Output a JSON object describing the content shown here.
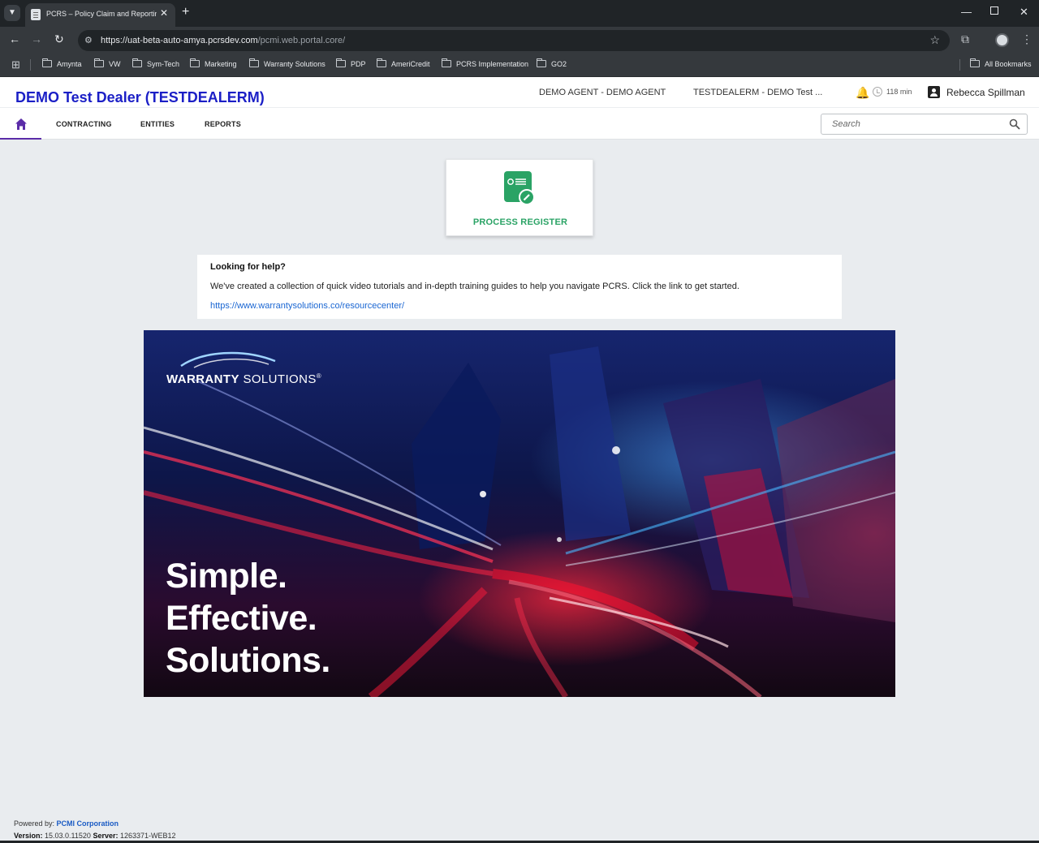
{
  "browser": {
    "tab_title": "PCRS – Policy Claim and Reporting",
    "url_host": "https://uat-beta-auto-amya.pcrsdev.com",
    "url_path": "/pcmi.web.portal.core/",
    "bookmarks": [
      "Amynta",
      "VW",
      "Sym-Tech",
      "Marketing",
      "Warranty Solutions",
      "PDP",
      "AmeriCredit",
      "PCRS Implementation",
      "GO2"
    ],
    "all_bookmarks": "All Bookmarks",
    "icons": {
      "tab_list": "chevron-down-icon",
      "close": "close-icon",
      "new_tab": "plus-icon",
      "minimize": "minimize-icon",
      "maximize": "maximize-icon",
      "window_close": "close-icon",
      "back": "arrow-left-icon",
      "forward": "arrow-right-icon",
      "reload": "reload-icon",
      "site_info": "tune-icon",
      "bookmark": "star-icon",
      "extensions": "puzzle-icon",
      "profile": "avatar-icon",
      "menu": "kebab-icon",
      "apps": "grid-icon",
      "folder": "folder-icon"
    }
  },
  "header": {
    "dealer_title": "DEMO Test Dealer (TESTDEALERM)",
    "agent": "DEMO AGENT - DEMO AGENT",
    "dealer_code": "TESTDEALERM - DEMO Test ...",
    "session_time": "118 min",
    "user_name": "Rebecca Spillman"
  },
  "nav": {
    "items": [
      "CONTRACTING",
      "ENTITIES",
      "REPORTS"
    ],
    "search_placeholder": "Search"
  },
  "process_card": {
    "label": "PROCESS REGISTER"
  },
  "help": {
    "title": "Looking for help?",
    "text": "We've created a collection of quick video tutorials and in-depth training guides to help you navigate PCRS. Click the link to get started.",
    "link": "https://www.warrantysolutions.co/resourcecenter/"
  },
  "banner": {
    "brand_bold": "WARRANTY",
    "brand_light": " SOLUTIONS",
    "brand_mark": "®",
    "tagline": [
      "Simple.",
      "Effective.",
      "Solutions."
    ]
  },
  "footer": {
    "powered_label": "Powered by:",
    "powered_company": "PCMI Corporation",
    "version_label": "Version:",
    "version_value": "15.03.0.11520",
    "server_label": "Server:",
    "server_value": "1263371-WEB12"
  },
  "colors": {
    "dealer_title": "#1b1fc6",
    "nav_active": "#5b2ca8",
    "process_green": "#2aa365",
    "link_blue": "#1a66d2",
    "chrome_dark": "#202427",
    "chrome_toolbar": "#35393d",
    "page_background": "#e9ecef"
  }
}
